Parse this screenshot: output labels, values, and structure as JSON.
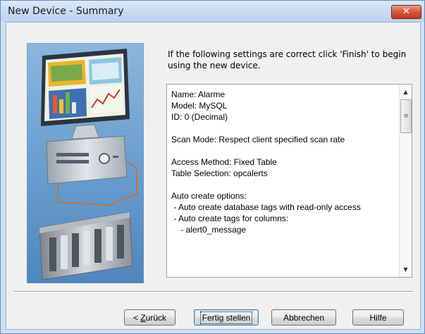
{
  "window": {
    "title": "New Device - Summary",
    "close_glyph": "✕"
  },
  "intro_text": "If the following settings are correct click 'Finish' to begin using the new device.",
  "summary_lines": [
    "Name: Alarme",
    "Model: MySQL",
    "ID: 0 (Decimal)",
    "",
    "Scan Mode: Respect client specified scan rate",
    "",
    "Access Method: Fixed Table",
    "Table Selection: opcalerts",
    "",
    "Auto create options:",
    " - Auto create database tags with read-only access",
    " - Auto create tags for columns:",
    "    - alert0_message"
  ],
  "scrollbar": {
    "up_glyph": "▲",
    "down_glyph": "▼",
    "grip_glyph": "≡"
  },
  "buttons": {
    "back_prefix": "< ",
    "back_mnemonic": "Z",
    "back_rest": "urück",
    "finish": "Fertig stellen",
    "cancel": "Abbrechen",
    "help": "Hilfe"
  },
  "colors": {
    "title_close": "#c7432a",
    "window_frame": "#cfdff3",
    "dialog_bg": "#f0f0f0",
    "illustration_bg": "#5c92c4"
  },
  "icons": [
    "close-icon",
    "computer-illustration",
    "scroll-up-icon",
    "scroll-down-icon"
  ]
}
